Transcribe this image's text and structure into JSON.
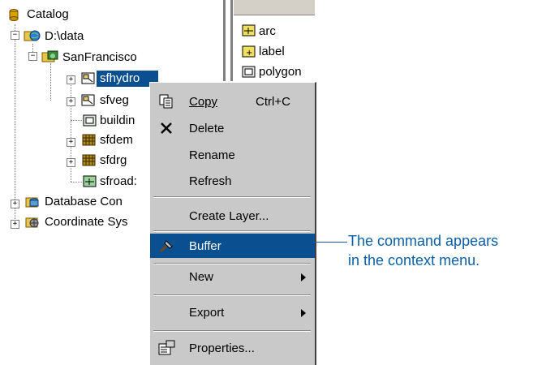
{
  "tree": {
    "root": "Catalog",
    "drive": "D:\\data",
    "dataset": "SanFrancisco",
    "children": [
      "sfhydro",
      "sfveg",
      "buildin",
      "sfdem",
      "sfdrg",
      "sfroad:"
    ],
    "db_connections": "Database Con",
    "coord_systems": "Coordinate Sys"
  },
  "right_list": [
    "arc",
    "label",
    "polygon"
  ],
  "menu": {
    "copy": "Copy",
    "copy_shortcut": "Ctrl+C",
    "delete": "Delete",
    "rename": "Rename",
    "refresh": "Refresh",
    "create_layer": "Create Layer...",
    "buffer": "Buffer",
    "new": "New",
    "export": "Export",
    "properties": "Properties..."
  },
  "callout": {
    "line1": "The command appears",
    "line2": "in the context menu."
  },
  "colors": {
    "selection": "#0a4f8f",
    "callout": "#0a5fa8",
    "menu_bg": "#c9c9c9"
  },
  "icons": [
    "catalog-icon",
    "folder-globe-icon",
    "dataset-icon",
    "coverage-icon",
    "grid-icon",
    "line-feature-icon",
    "polygon-feature-icon",
    "database-icon",
    "coordinate-icon",
    "copy-icon",
    "delete-icon",
    "buffer-hammer-icon",
    "properties-icon"
  ]
}
